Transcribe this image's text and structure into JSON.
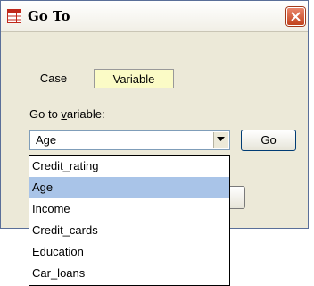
{
  "window": {
    "title": "Go To"
  },
  "tabs": [
    {
      "label": "Case",
      "active": false
    },
    {
      "label": "Variable",
      "active": true
    }
  ],
  "goto_label": "Go to variable:",
  "combo": {
    "value": "Age"
  },
  "go_button_label": "Go",
  "dropdown": {
    "items": [
      "Credit_rating",
      "Age",
      "Income",
      "Credit_cards",
      "Education",
      "Car_loans"
    ],
    "selected_index": 1
  },
  "colors": {
    "active_tab": "#fbfbc6",
    "selection": "#a9c4e8",
    "close_button": "#c1421d",
    "dialog_bg": "#ece9d8"
  },
  "icons": {
    "app": "grid-table-icon",
    "close": "close-icon",
    "dropdown": "chevron-down-icon"
  }
}
